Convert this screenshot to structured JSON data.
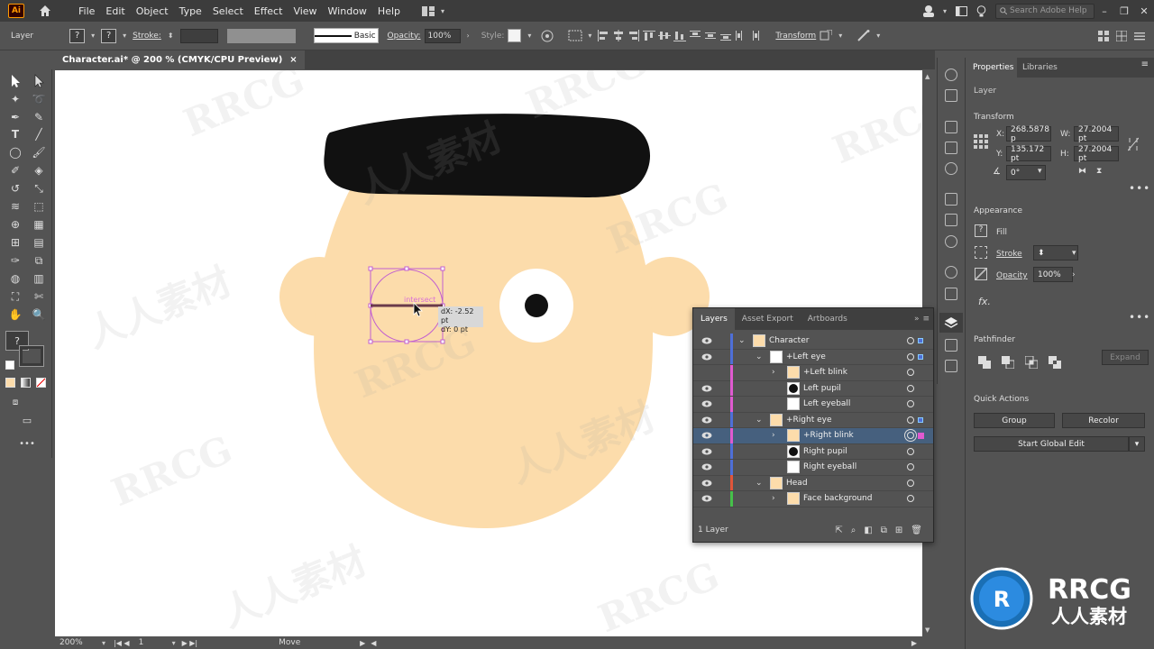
{
  "app": {
    "logo": "Ai"
  },
  "menu": [
    "File",
    "Edit",
    "Object",
    "Type",
    "Select",
    "Effect",
    "View",
    "Window",
    "Help"
  ],
  "search": {
    "placeholder": "Search Adobe Help"
  },
  "control": {
    "selection_label": "Layer",
    "stroke_label": "Stroke:",
    "stroke_style": "Basic",
    "opacity_label": "Opacity:",
    "opacity_value": "100%",
    "style_label": "Style:",
    "transform_label": "Transform"
  },
  "document": {
    "tab_title": "Character.ai* @ 200 % (CMYK/CPU Preview)",
    "close": "×"
  },
  "canvas": {
    "smart_guide": "intersect",
    "tooltip_dx": "dX: -2.52 pt",
    "tooltip_dy": "dY: 0 pt"
  },
  "status": {
    "zoom": "200%",
    "artboard": "1",
    "tool": "Move"
  },
  "properties": {
    "tabs": [
      "Properties",
      "Libraries"
    ],
    "selection": "Layer",
    "transform": {
      "title": "Transform",
      "x_label": "X:",
      "x": "268.5878 p",
      "y_label": "Y:",
      "y": "135.172 pt",
      "w_label": "W:",
      "w": "27.2004 pt",
      "h_label": "H:",
      "h": "27.2004 pt",
      "angle": "0°"
    },
    "appearance": {
      "title": "Appearance",
      "fill": "Fill",
      "stroke": "Stroke",
      "opacity_label": "Opacity",
      "opacity": "100%",
      "fx": "fx."
    },
    "pathfinder": {
      "title": "Pathfinder",
      "expand": "Expand"
    },
    "quick_actions": {
      "title": "Quick Actions",
      "group": "Group",
      "recolor": "Recolor",
      "global_edit": "Start Global Edit"
    },
    "more": "•••"
  },
  "layers_panel": {
    "tabs": [
      "Layers",
      "Asset Export",
      "Artboards"
    ],
    "rows": [
      {
        "name": "Character",
        "color": "#4e6fd8"
      },
      {
        "name": "+Left eye",
        "color": "#4e6fd8"
      },
      {
        "name": "+Left blink",
        "color": "#e05ad0"
      },
      {
        "name": "Left pupil",
        "color": "#e05ad0"
      },
      {
        "name": "Left eyeball",
        "color": "#e05ad0"
      },
      {
        "name": "+Right eye",
        "color": "#4e6fd8"
      },
      {
        "name": "+Right blink",
        "color": "#e05ad0"
      },
      {
        "name": "Right pupil",
        "color": "#4e6fd8"
      },
      {
        "name": "Right eyeball",
        "color": "#4e6fd8"
      },
      {
        "name": "Head",
        "color": "#e0553a"
      },
      {
        "name": "Face background",
        "color": "#46c04a"
      }
    ],
    "footer": "1 Layer"
  },
  "watermark": {
    "latin": "RRCG",
    "cjk": "人人素材"
  },
  "brand": {
    "name": "RRCG",
    "sub": "人人素材"
  },
  "colors": {
    "face": "#fcdcab",
    "hat": "#111111",
    "selection": "#c25fd0",
    "accent_blue": "#46607e"
  }
}
